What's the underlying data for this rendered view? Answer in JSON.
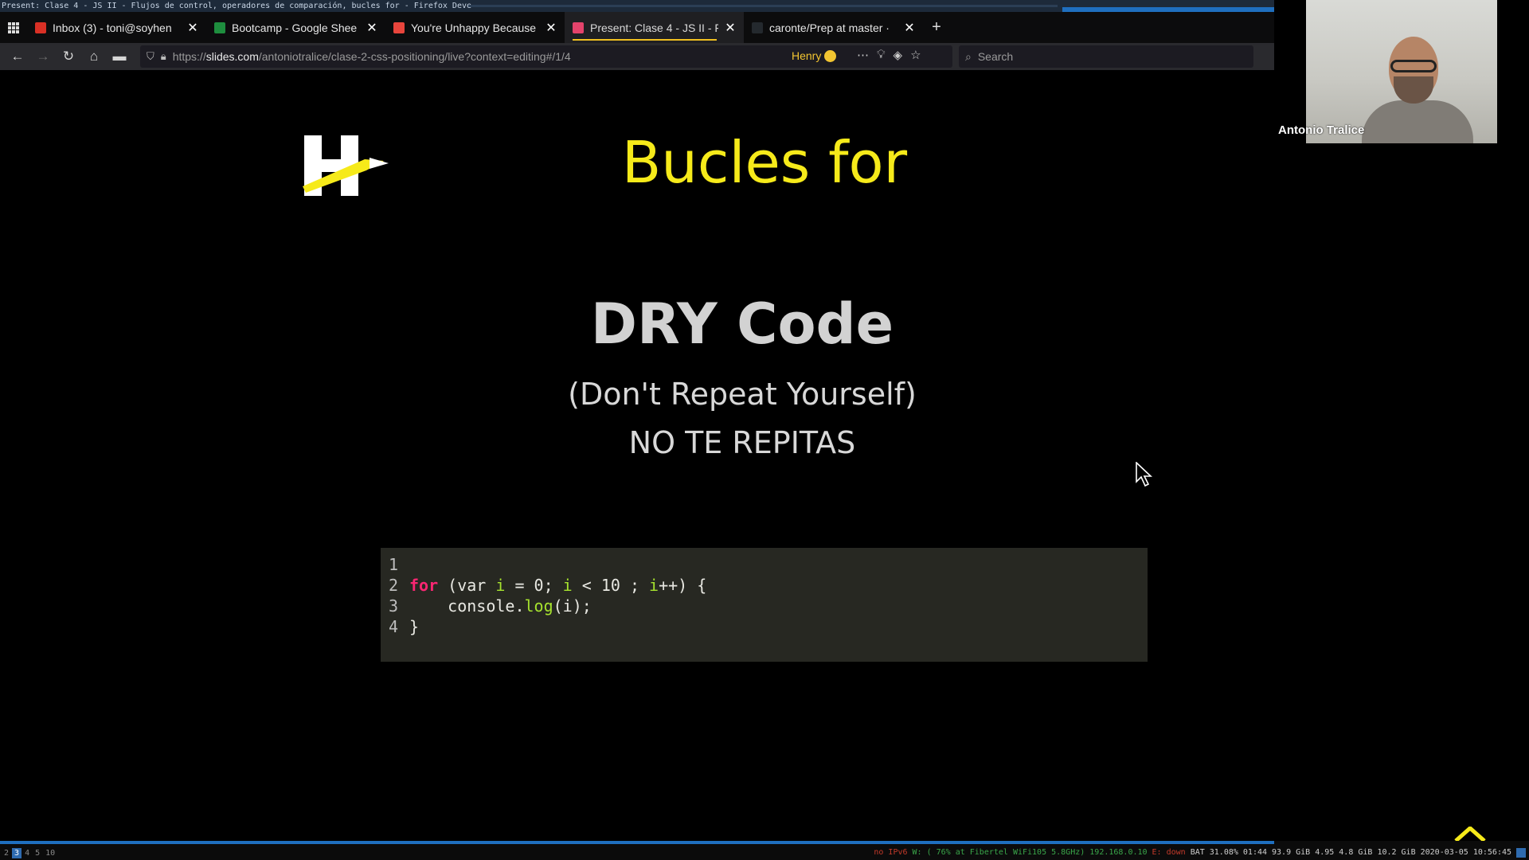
{
  "os": {
    "window_title": "Present: Clase 4 - JS II - Flujos de control, operadores de comparación, bucles for - Firefox Deve"
  },
  "tabs": [
    {
      "label": "Inbox (3) - toni@soyhen",
      "favicon_color": "#d93025",
      "icon": "gmail-icon"
    },
    {
      "label": "Bootcamp - Google Shee",
      "favicon_color": "#1e8e3e",
      "icon": "sheets-icon"
    },
    {
      "label": "You're Unhappy Because",
      "favicon_color": "#e8453c",
      "icon": "site-icon"
    },
    {
      "label": "Present: Clase 4 - JS II - F",
      "favicon_color": "#e4436b",
      "icon": "slides-icon"
    },
    {
      "label": "caronte/Prep at master ·",
      "favicon_color": "#24292e",
      "icon": "github-icon"
    }
  ],
  "nav": {
    "url_prefix": "https://",
    "url_domain": "slides.com",
    "url_path": "/antoniotralice/clase-2-css-positioning/live?context=editing#/1/4",
    "extension_label": "Henry",
    "search_placeholder": "Search"
  },
  "slide": {
    "title": "Bucles for",
    "heading": "DRY Code",
    "subtitle": "(Don't Repeat Yourself)",
    "note": "NO TE REPITAS",
    "code_lines": [
      "1",
      "2",
      "3",
      "4"
    ]
  },
  "code": {
    "kw_for": "for",
    "open": " (var ",
    "var_i": "i",
    "eq": " = 0; ",
    "lt": " < 10 ; ",
    "inc": "++) {",
    "console": "console.",
    "log": "log",
    "args": "(i);",
    "close": "}"
  },
  "webcam": {
    "name": "Antonio Tralice"
  },
  "statusbar": {
    "workspaces": [
      "2",
      "3",
      "4",
      "5",
      "10"
    ],
    "active_workspace": "3",
    "ipv6": "no IPv6",
    "wifi": "W: ( 76% at Fibertel WiFi105 5.8GHz) 192.168.0.10",
    "eth": "E: down",
    "battery": "BAT 31.08% 01:44",
    "disk1": "93.9 GiB",
    "load": "4.95",
    "mem": "4.8 GiB",
    "disk2": "10.2 GiB",
    "datetime": "2020-03-05 10:56:45"
  },
  "colors": {
    "title_yellow": "#f6ea1a",
    "accent_blue": "#1f6fbf",
    "code_bg": "#272822"
  }
}
